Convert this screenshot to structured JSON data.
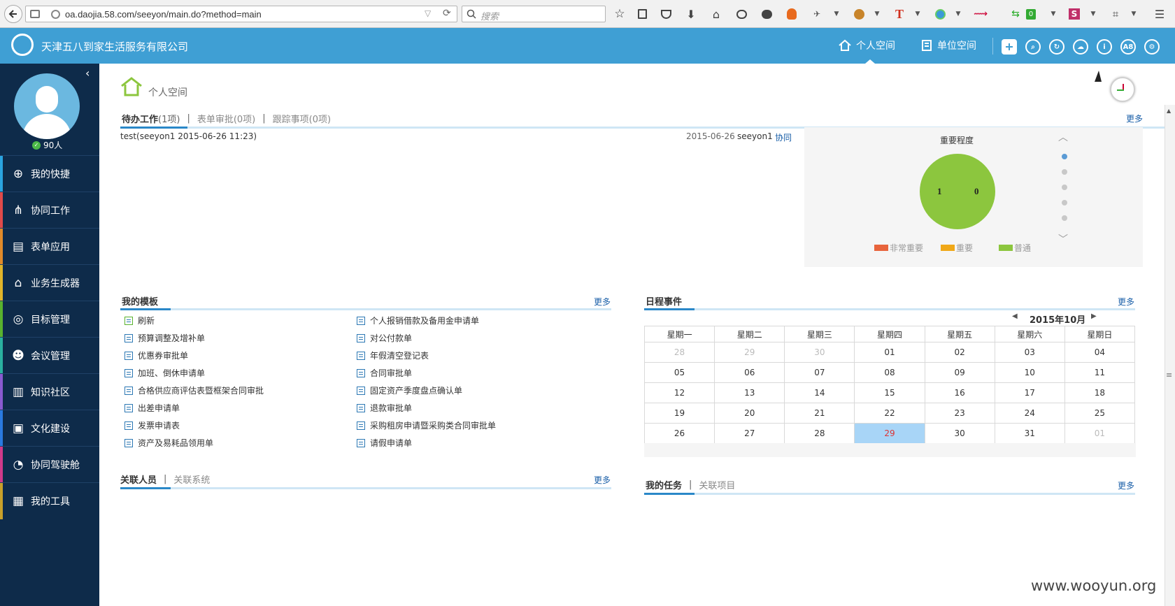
{
  "browser": {
    "url": "oa.daojia.58.com/seeyon/main.do?method=main",
    "search_placeholder": "搜索"
  },
  "header": {
    "company": "天津五八到家生活服务有限公司",
    "nav": [
      "个人空间",
      "单位空间"
    ],
    "icon_text": "A8"
  },
  "sidebar": {
    "online": "90人",
    "items": [
      {
        "label": "我的快捷",
        "color": "#2aa4e0"
      },
      {
        "label": "协同工作",
        "color": "#e04a4a"
      },
      {
        "label": "表单应用",
        "color": "#e08a2a"
      },
      {
        "label": "业务生成器",
        "color": "#e0b42a"
      },
      {
        "label": "目标管理",
        "color": "#59b22e"
      },
      {
        "label": "会议管理",
        "color": "#2ab0a0"
      },
      {
        "label": "知识社区",
        "color": "#8a5ad0"
      },
      {
        "label": "文化建设",
        "color": "#2a7ae0"
      },
      {
        "label": "协同驾驶舱",
        "color": "#d03a8a"
      },
      {
        "label": "我的工具",
        "color": "#c8a02a"
      }
    ]
  },
  "page": {
    "title": "个人空间"
  },
  "pending": {
    "tabs": [
      "待办工作",
      "(1项)",
      "表单审批(0项)",
      "跟踪事项(0项)"
    ],
    "more": "更多",
    "row": {
      "subject": "test(seeyon1 2015-06-26 11:23)",
      "date": "2015-06-26",
      "sender": "seeyon1",
      "type": "协同"
    }
  },
  "importance": {
    "title": "重要程度",
    "pie_labels": [
      "1",
      "0"
    ],
    "legend": [
      {
        "label": "非常重要",
        "color": "#e8643c"
      },
      {
        "label": "重要",
        "color": "#f0a818"
      },
      {
        "label": "普通",
        "color": "#8cc63e"
      }
    ],
    "pie_color": "#8cc63e"
  },
  "templates": {
    "title": "我的模板",
    "more": "更多",
    "left": [
      "刷新",
      "预算调整及增补单",
      "优惠券审批单",
      "加班、倒休申请单",
      "合格供应商评估表暨框架合同审批",
      "出差申请单",
      "发票申请表",
      "资产及易耗品领用单"
    ],
    "right": [
      "个人报销借款及备用金申请单",
      "对公付款单",
      "年假清空登记表",
      "合同审批单",
      "固定资产季度盘点确认单",
      "退款审批单",
      "采购租房申请暨采购类合同审批单",
      "请假申请单"
    ]
  },
  "schedule": {
    "title": "日程事件",
    "more": "更多",
    "month": "2015年10月",
    "weekdays": [
      "星期一",
      "星期二",
      "星期三",
      "星期四",
      "星期五",
      "星期六",
      "星期日"
    ],
    "weeks": [
      [
        "28",
        "29",
        "30",
        "01",
        "02",
        "03",
        "04"
      ],
      [
        "05",
        "06",
        "07",
        "08",
        "09",
        "10",
        "11"
      ],
      [
        "12",
        "13",
        "14",
        "15",
        "16",
        "17",
        "18"
      ],
      [
        "19",
        "20",
        "21",
        "22",
        "23",
        "24",
        "25"
      ],
      [
        "26",
        "27",
        "28",
        "29",
        "30",
        "31",
        "01"
      ]
    ],
    "today": "29"
  },
  "related": {
    "tabs": [
      "关联人员",
      "关联系统"
    ],
    "more": "更多"
  },
  "tasks": {
    "tabs": [
      "我的任务",
      "关联项目"
    ],
    "more": "更多"
  },
  "watermark": "www.wooyun.org"
}
